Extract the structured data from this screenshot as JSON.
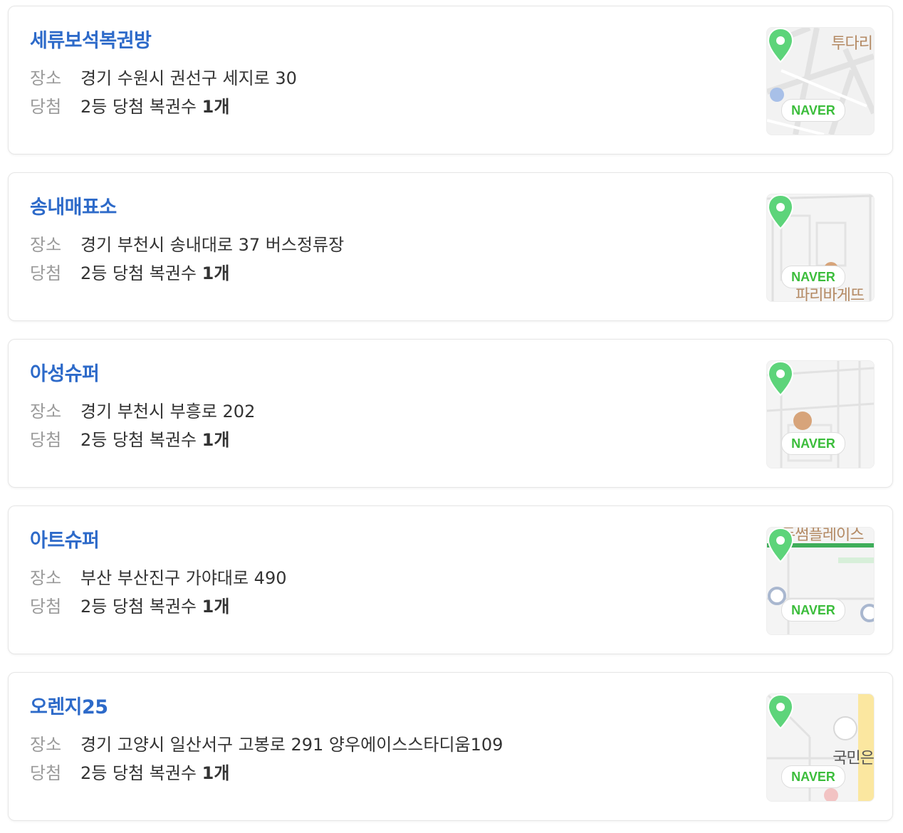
{
  "stores": [
    {
      "name": "세류보석복권방",
      "place_label": "장소",
      "address": "경기 수원시 권선구 세지로 30",
      "win_label": "당첨",
      "win_text": "2등 당첨 복권수 ",
      "win_count": "1개",
      "map": {
        "brand": "NAVER",
        "label_top": "투다리",
        "label_bottom": ""
      }
    },
    {
      "name": "송내매표소",
      "place_label": "장소",
      "address": "경기 부천시 송내대로 37 버스정류장",
      "win_label": "당첨",
      "win_text": "2등 당첨 복권수 ",
      "win_count": "1개",
      "map": {
        "brand": "NAVER",
        "label_top": "",
        "label_bottom": "파리바게뜨"
      }
    },
    {
      "name": "아성슈퍼",
      "place_label": "장소",
      "address": "경기 부천시 부흥로 202",
      "win_label": "당첨",
      "win_text": "2등 당첨 복권수 ",
      "win_count": "1개",
      "map": {
        "brand": "NAVER",
        "label_top": "",
        "label_bottom": ""
      }
    },
    {
      "name": "아트슈퍼",
      "place_label": "장소",
      "address": "부산 부산진구 가야대로 490",
      "win_label": "당첨",
      "win_text": "2등 당첨 복권수 ",
      "win_count": "1개",
      "map": {
        "brand": "NAVER",
        "label_top": "두썸플레이스",
        "label_bottom": ""
      }
    },
    {
      "name": "오렌지25",
      "place_label": "장소",
      "address": "경기 고양시 일산서구 고봉로 291 양우에이스스타디움109",
      "win_label": "당첨",
      "win_text": "2등 당첨 복권수 ",
      "win_count": "1개",
      "map": {
        "brand": "NAVER",
        "label_top": "",
        "label_bottom": "국민은"
      }
    }
  ],
  "colors": {
    "store_name": "#2d6ac9",
    "label": "#9a9a9a",
    "pin": "#5dd47a",
    "naver": "#3bbd3b"
  },
  "icons": [
    "map-pin-icon"
  ]
}
